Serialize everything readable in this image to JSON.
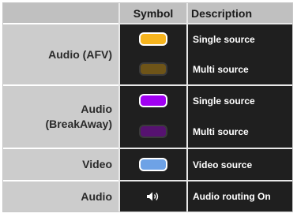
{
  "header": {
    "col_group": "",
    "col_symbol": "Symbol",
    "col_description": "Description"
  },
  "groups": [
    {
      "label": "Audio (AFV)",
      "rows": [
        {
          "symbol": {
            "kind": "swatch",
            "fill": "#f6b41e",
            "stroke": "#ffffff"
          },
          "description": "Single source"
        },
        {
          "symbol": {
            "kind": "swatch",
            "fill": "#6e5418",
            "stroke": "#3a3a3a"
          },
          "description": "Multi source"
        }
      ]
    },
    {
      "label_line1": "Audio",
      "label_line2": "(BreakAway)",
      "rows": [
        {
          "symbol": {
            "kind": "swatch",
            "fill": "#a100f2",
            "stroke": "#ffffff"
          },
          "description": "Single source"
        },
        {
          "symbol": {
            "kind": "swatch",
            "fill": "#561270",
            "stroke": "#3a3a3a"
          },
          "description": "Multi source"
        }
      ]
    },
    {
      "label": "Video",
      "rows": [
        {
          "symbol": {
            "kind": "swatch",
            "fill": "#6ea2e6",
            "stroke": "#ffffff"
          },
          "description": "Video source"
        }
      ]
    },
    {
      "label": "Audio",
      "rows": [
        {
          "symbol": {
            "kind": "icon",
            "icon": "speaker-icon",
            "color": "#ffffff"
          },
          "description": "Audio routing On"
        }
      ]
    }
  ]
}
